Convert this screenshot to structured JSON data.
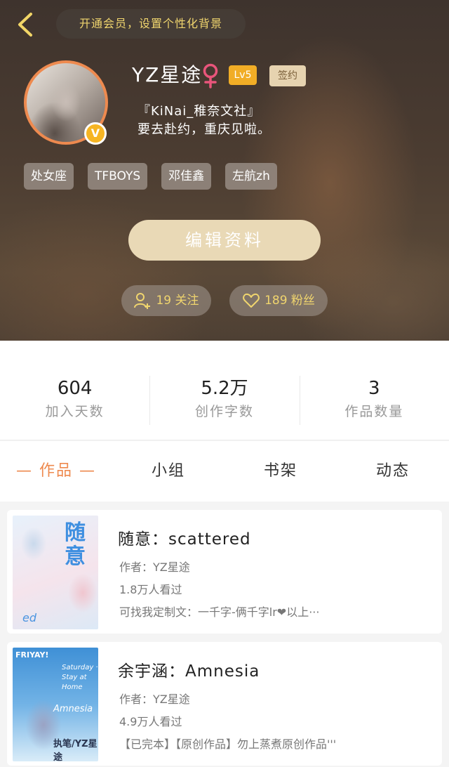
{
  "header": {
    "vip_text": "开通会员，设置个性化背景",
    "username": "YZ星途",
    "level": "Lv5",
    "signed": "签约",
    "verified_mark": "V",
    "bio": [
      "『KiNai_稚奈文社』",
      "要去赴约，重庆见啦。"
    ],
    "tags": [
      "处女座",
      "TFBOYS",
      "邓佳鑫",
      "左航zh"
    ],
    "edit_button": "编辑资料",
    "follow": "19 关注",
    "fans": "189 粉丝",
    "gender_color": "#e9557b",
    "accent": "#f0d56e"
  },
  "stats": [
    {
      "value": "604",
      "label": "加入天数"
    },
    {
      "value": "5.2万",
      "label": "创作字数"
    },
    {
      "value": "3",
      "label": "作品数量"
    }
  ],
  "tabs": [
    {
      "label": "— 作品 —",
      "active": true
    },
    {
      "label": "小组",
      "active": false
    },
    {
      "label": "书架",
      "active": false
    },
    {
      "label": "动态",
      "active": false
    }
  ],
  "works": [
    {
      "title": "随意：scattered",
      "author": "作者：YZ星途",
      "views": "1.8万人看过",
      "desc": "可找我定制文：一千字-俩千字lr❤以上···",
      "cover_big": "随意",
      "cover_small": "ed"
    },
    {
      "title": "余宇涵：Amnesia",
      "author": "作者：YZ星途",
      "views": "4.9万人看过",
      "desc": "【已完本】【原创作品】勿上蒸煮原创作品'''",
      "cover_top": "FRIYAY!",
      "cover_sub": "Saturday · Stay at Home",
      "cover_mid": "Amnesia",
      "cover_bot": "执笔/YZ星途"
    }
  ]
}
